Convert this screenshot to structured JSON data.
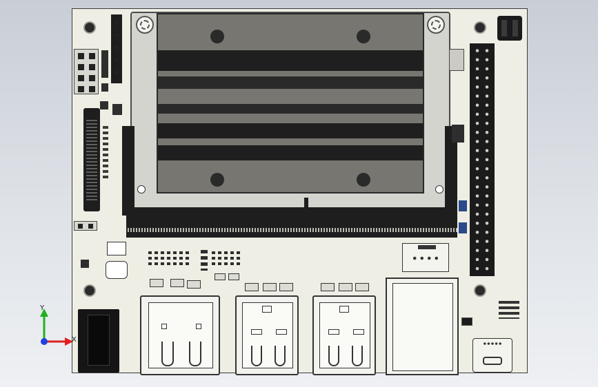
{
  "viewport": {
    "axes": {
      "x_label": "X",
      "y_label": "Y"
    }
  },
  "colors": {
    "background_top": "#c9ced6",
    "board": "#eeeee4",
    "heatsink": "#777670",
    "connector": "#1e1e1e",
    "axis_x": "#e02020",
    "axis_y": "#20b020",
    "axis_z": "#2040e0"
  },
  "icons": [
    "mounting-hole-icon",
    "screw-icon",
    "usb-port-icon",
    "ethernet-port-icon",
    "power-jack-icon",
    "micro-usb-icon",
    "gpio-header-icon"
  ]
}
